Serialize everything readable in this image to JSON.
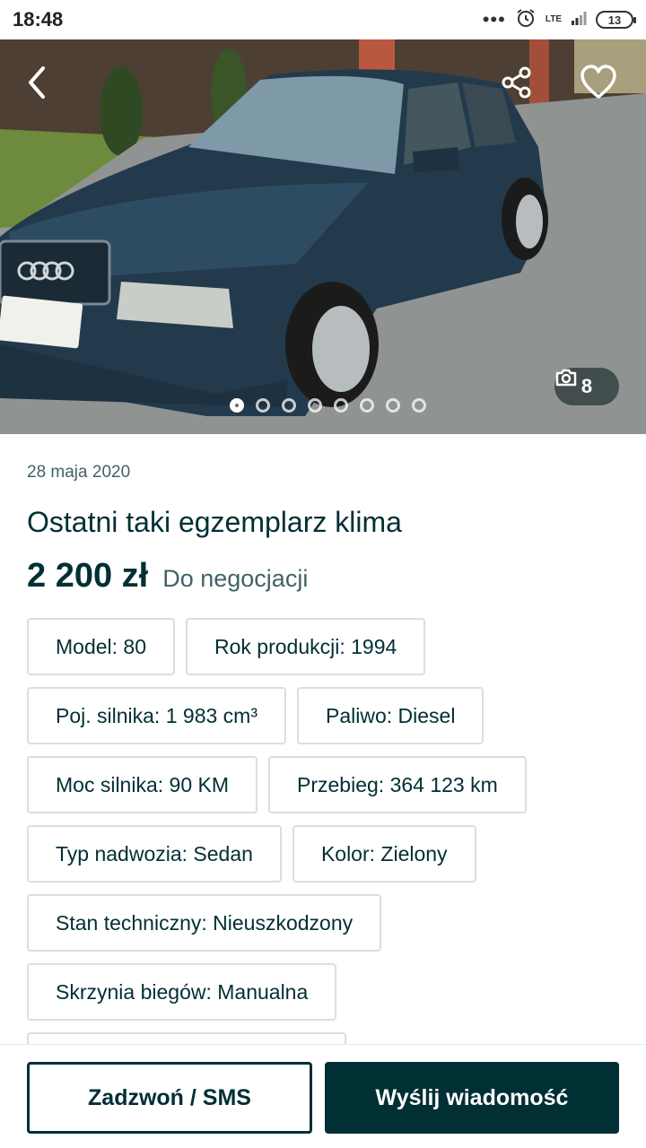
{
  "status_bar": {
    "time": "18:48",
    "dots": "•••",
    "network": "LTE",
    "battery": "13"
  },
  "gallery": {
    "photo_count": "8",
    "dot_count": 8,
    "active_dot": 0
  },
  "ad": {
    "date": "28 maja 2020",
    "title": "Ostatni taki egzemplarz klima",
    "price": "2 200 zł",
    "negotiable": "Do negocjacji"
  },
  "params": [
    "Model: 80",
    "Rok produkcji: 1994",
    "Poj. silnika: 1 983 cm³",
    "Paliwo: Diesel",
    "Moc silnika: 90 KM",
    "Przebieg: 364 123 km",
    "Typ nadwozia: Sedan",
    "Kolor: Zielony",
    "Stan techniczny: Nieuszkodzony",
    "Skrzynia biegów: Manualna"
  ],
  "actions": {
    "call": "Zadzwoń / SMS",
    "message": "Wyślij wiadomość"
  },
  "colors": {
    "primary": "#002f34",
    "muted": "#406367",
    "border": "#d8dfe0"
  }
}
